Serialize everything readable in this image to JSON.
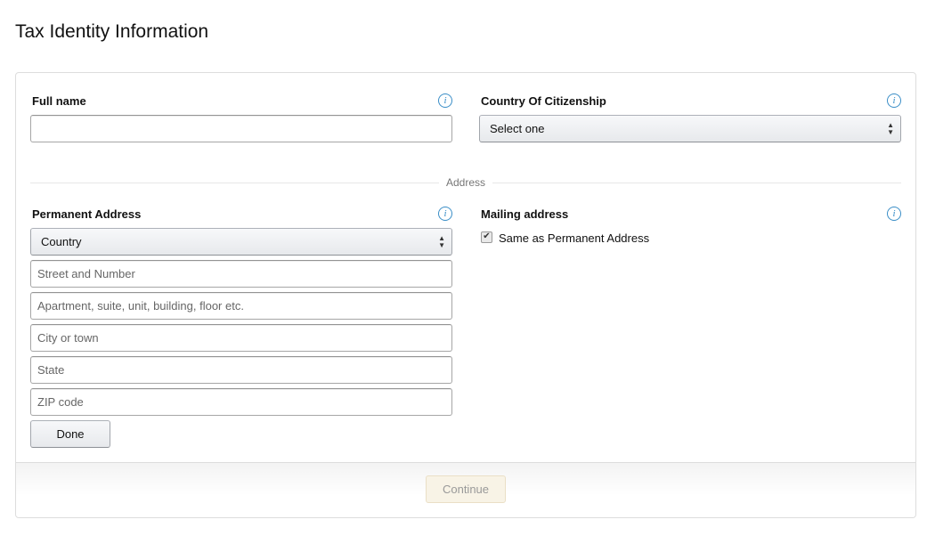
{
  "page": {
    "title": "Tax Identity Information"
  },
  "full_name": {
    "label": "Full name",
    "value": "",
    "placeholder": "",
    "info_icon": "info-icon"
  },
  "citizenship": {
    "label": "Country Of Citizenship",
    "selected": "Select one",
    "info_icon": "info-icon"
  },
  "address_section": {
    "label": "Address"
  },
  "permanent_address": {
    "label": "Permanent Address",
    "country_selected": "Country",
    "fields": [
      {
        "name": "street",
        "placeholder": "Street and Number",
        "value": ""
      },
      {
        "name": "apartment",
        "placeholder": "Apartment, suite, unit, building, floor etc.",
        "value": ""
      },
      {
        "name": "city",
        "placeholder": "City or town",
        "value": ""
      },
      {
        "name": "state",
        "placeholder": "State",
        "value": ""
      },
      {
        "name": "zip",
        "placeholder": "ZIP code",
        "value": ""
      }
    ],
    "done_label": "Done"
  },
  "mailing_address": {
    "label": "Mailing address",
    "same_as_permanent_label": "Same as Permanent Address",
    "same_as_permanent_checked": true
  },
  "footer": {
    "continue_label": "Continue",
    "continue_disabled": true
  },
  "colors": {
    "info_icon": "#3a8ec7",
    "continue_bg": "#f8f3e6",
    "continue_text": "#999999"
  }
}
